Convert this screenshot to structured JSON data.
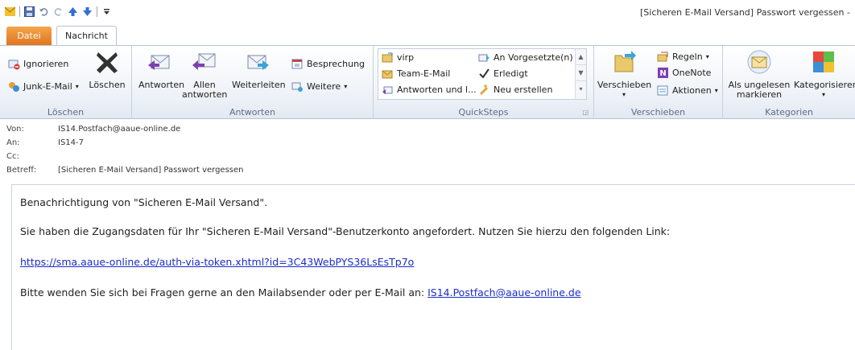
{
  "window": {
    "title": "[Sicheren E-Mail Versand] Passwort vergessen -"
  },
  "tabs": {
    "file": "Datei",
    "message": "Nachricht"
  },
  "ribbon": {
    "loeschen": {
      "label": "Löschen",
      "ignore": "Ignorieren",
      "junk": "Junk-E-Mail",
      "delete": "Löschen"
    },
    "antworten": {
      "label": "Antworten",
      "reply": "Antworten",
      "reply_all_1": "Allen",
      "reply_all_2": "antworten",
      "forward": "Weiterleiten",
      "meeting": "Besprechung",
      "more": "Weitere"
    },
    "quicksteps": {
      "label": "QuickSteps",
      "items": [
        "virp",
        "An Vorgesetzte(n)",
        "Team-E-Mail",
        "Erledigt",
        "Antworten und l...",
        "Neu erstellen"
      ]
    },
    "verschieben": {
      "label": "Verschieben",
      "move": "Verschieben",
      "rules": "Regeln",
      "onenote": "OneNote",
      "actions": "Aktionen"
    },
    "kategorien": {
      "label": "Kategorien",
      "unread_1": "Als ungelesen",
      "unread_2": "markieren",
      "categorize": "Kategorisieren"
    }
  },
  "header": {
    "from_label": "Von:",
    "from": "IS14.Postfach@aaue-online.de",
    "to_label": "An:",
    "to": "IS14-7",
    "cc_label": "Cc:",
    "cc": "",
    "subject_label": "Betreff:",
    "subject": "[Sicheren E-Mail Versand] Passwort vergessen"
  },
  "body": {
    "line1": "Benachrichtigung von \"Sicheren E-Mail Versand\".",
    "line2": "Sie haben die Zugangsdaten für Ihr \"Sicheren E-Mail Versand\"-Benutzerkonto angefordert. Nutzen Sie hierzu den folgenden Link:",
    "link": "https://sma.aaue-online.de/auth-via-token.xhtml?id=3C43WebPYS36LsEsTp7o",
    "line4_prefix": "Bitte wenden Sie sich bei Fragen gerne an den Mailabsender oder per E-Mail an: ",
    "email_link": "IS14.Postfach@aaue-online.de"
  },
  "colors": {
    "file_tab": "#e0751f",
    "link": "#1a2dc8",
    "group_label": "#5c6d86"
  }
}
